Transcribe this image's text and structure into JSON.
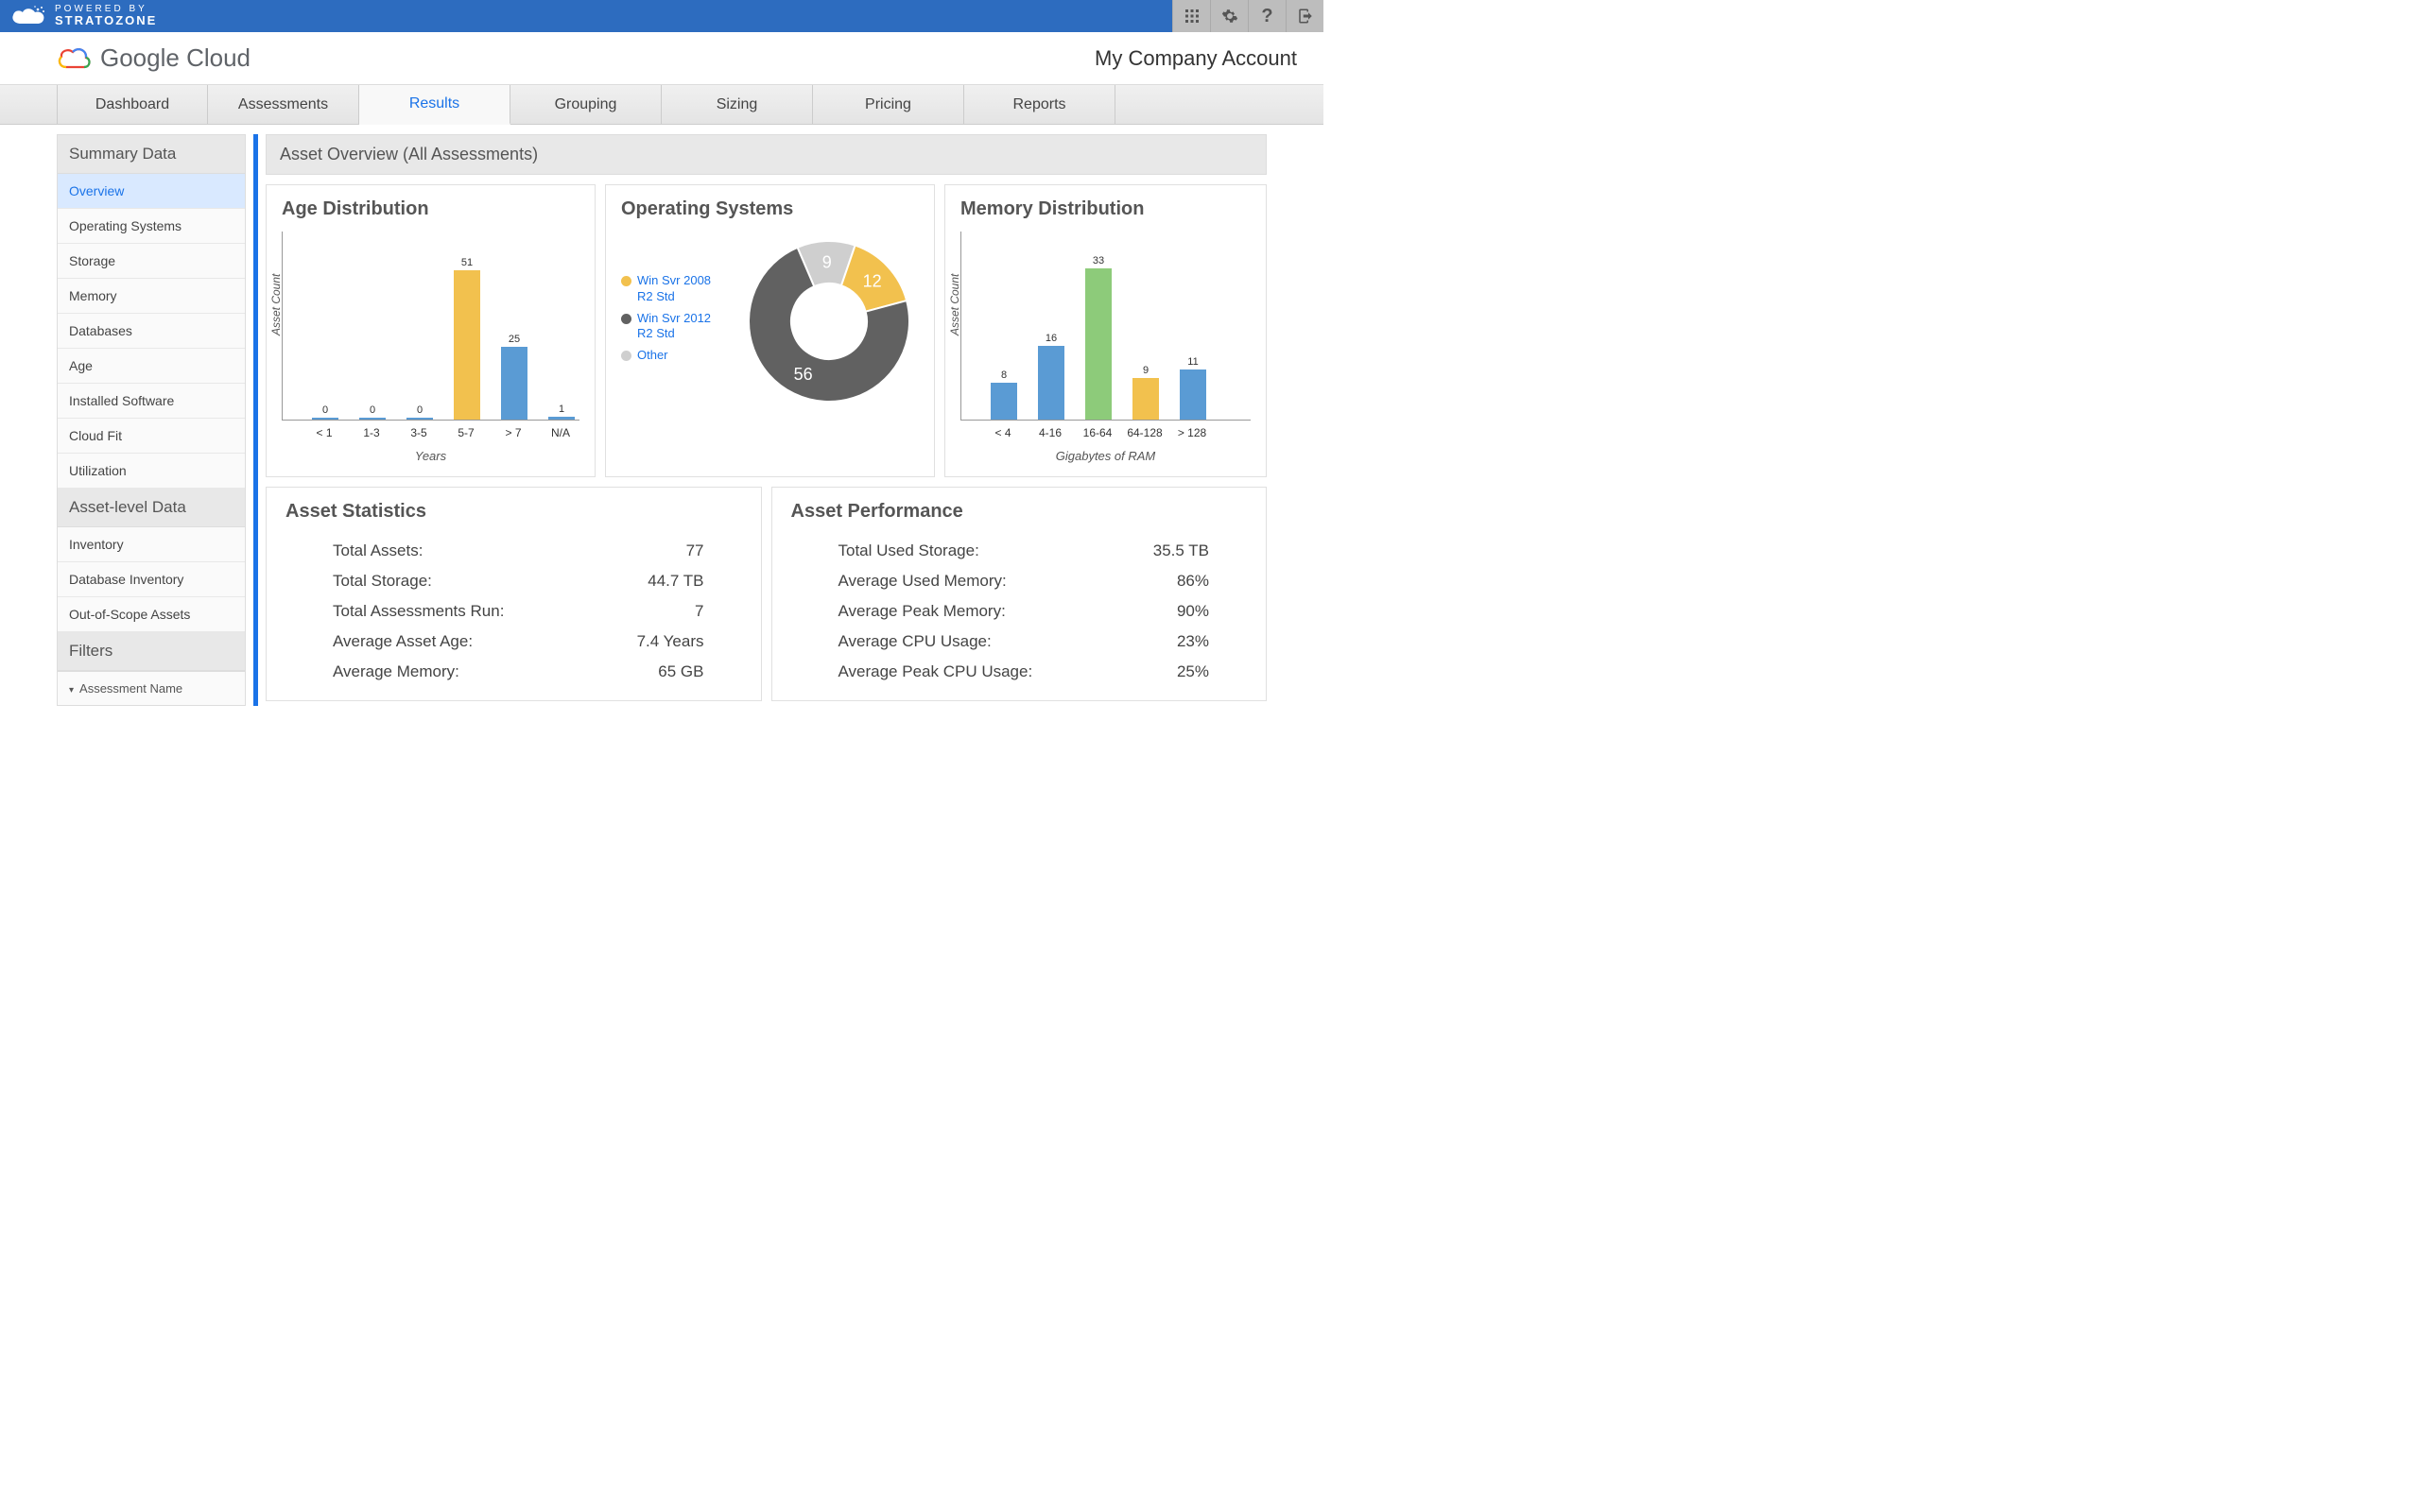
{
  "brand": {
    "powered_by": "POWERED BY",
    "name": "STRATOZONE"
  },
  "header": {
    "logo_text": "Google Cloud",
    "account": "My Company Account"
  },
  "nav": {
    "items": [
      "Dashboard",
      "Assessments",
      "Results",
      "Grouping",
      "Sizing",
      "Pricing",
      "Reports"
    ],
    "active_index": 2
  },
  "sidebar": {
    "section1_title": "Summary Data",
    "section1_items": [
      "Overview",
      "Operating Systems",
      "Storage",
      "Memory",
      "Databases",
      "Age",
      "Installed Software",
      "Cloud Fit",
      "Utilization"
    ],
    "section1_active": 0,
    "section2_title": "Asset-level Data",
    "section2_items": [
      "Inventory",
      "Database Inventory",
      "Out-of-Scope Assets"
    ],
    "section3_title": "Filters",
    "filter_label": "Assessment Name"
  },
  "content_title": "Asset Overview (All Assessments)",
  "age_chart": {
    "title": "Age Distribution",
    "ylabel": "Asset Count",
    "xcaption": "Years"
  },
  "os_chart": {
    "title": "Operating Systems",
    "legend": [
      {
        "label": "Win Svr 2008 R2 Std",
        "color": "#f2c14e"
      },
      {
        "label": "Win Svr 2012 R2 Std",
        "color": "#616161"
      },
      {
        "label": "Other",
        "color": "#cfcfcf"
      }
    ]
  },
  "mem_chart": {
    "title": "Memory Distribution",
    "ylabel": "Asset Count",
    "xcaption": "Gigabytes of RAM"
  },
  "stats": {
    "title": "Asset Statistics",
    "rows": [
      {
        "label": "Total Assets:",
        "value": "77"
      },
      {
        "label": "Total Storage:",
        "value": "44.7 TB"
      },
      {
        "label": "Total Assessments Run:",
        "value": "7"
      },
      {
        "label": "Average Asset Age:",
        "value": "7.4 Years"
      },
      {
        "label": "Average Memory:",
        "value": "65 GB"
      }
    ]
  },
  "perf": {
    "title": "Asset Performance",
    "rows": [
      {
        "label": "Total Used Storage:",
        "value": "35.5 TB"
      },
      {
        "label": "Average Used Memory:",
        "value": "86%"
      },
      {
        "label": "Average Peak Memory:",
        "value": "90%"
      },
      {
        "label": "Average CPU Usage:",
        "value": "23%"
      },
      {
        "label": "Average Peak CPU Usage:",
        "value": "25%"
      }
    ]
  },
  "chart_data": [
    {
      "type": "bar",
      "title": "Age Distribution",
      "ylabel": "Asset Count",
      "xlabel": "Years",
      "categories": [
        "< 1",
        "1-3",
        "3-5",
        "5-7",
        "> 7",
        "N/A"
      ],
      "values": [
        0,
        0,
        0,
        51,
        25,
        1
      ],
      "colors": [
        "#5a9bd4",
        "#5a9bd4",
        "#5a9bd4",
        "#f2c14e",
        "#5a9bd4",
        "#5a9bd4"
      ],
      "ylim": [
        0,
        55
      ]
    },
    {
      "type": "pie",
      "title": "Operating Systems",
      "series": [
        {
          "name": "Win Svr 2008 R2 Std",
          "value": 12,
          "color": "#f2c14e"
        },
        {
          "name": "Win Svr 2012 R2 Std",
          "value": 56,
          "color": "#616161"
        },
        {
          "name": "Other",
          "value": 9,
          "color": "#cfcfcf"
        }
      ]
    },
    {
      "type": "bar",
      "title": "Memory Distribution",
      "ylabel": "Asset Count",
      "xlabel": "Gigabytes of RAM",
      "categories": [
        "< 4",
        "4-16",
        "16-64",
        "64-128",
        "> 128"
      ],
      "values": [
        8,
        16,
        33,
        9,
        11
      ],
      "colors": [
        "#5a9bd4",
        "#5a9bd4",
        "#8dcb7a",
        "#f2c14e",
        "#5a9bd4"
      ],
      "ylim": [
        0,
        35
      ]
    }
  ]
}
